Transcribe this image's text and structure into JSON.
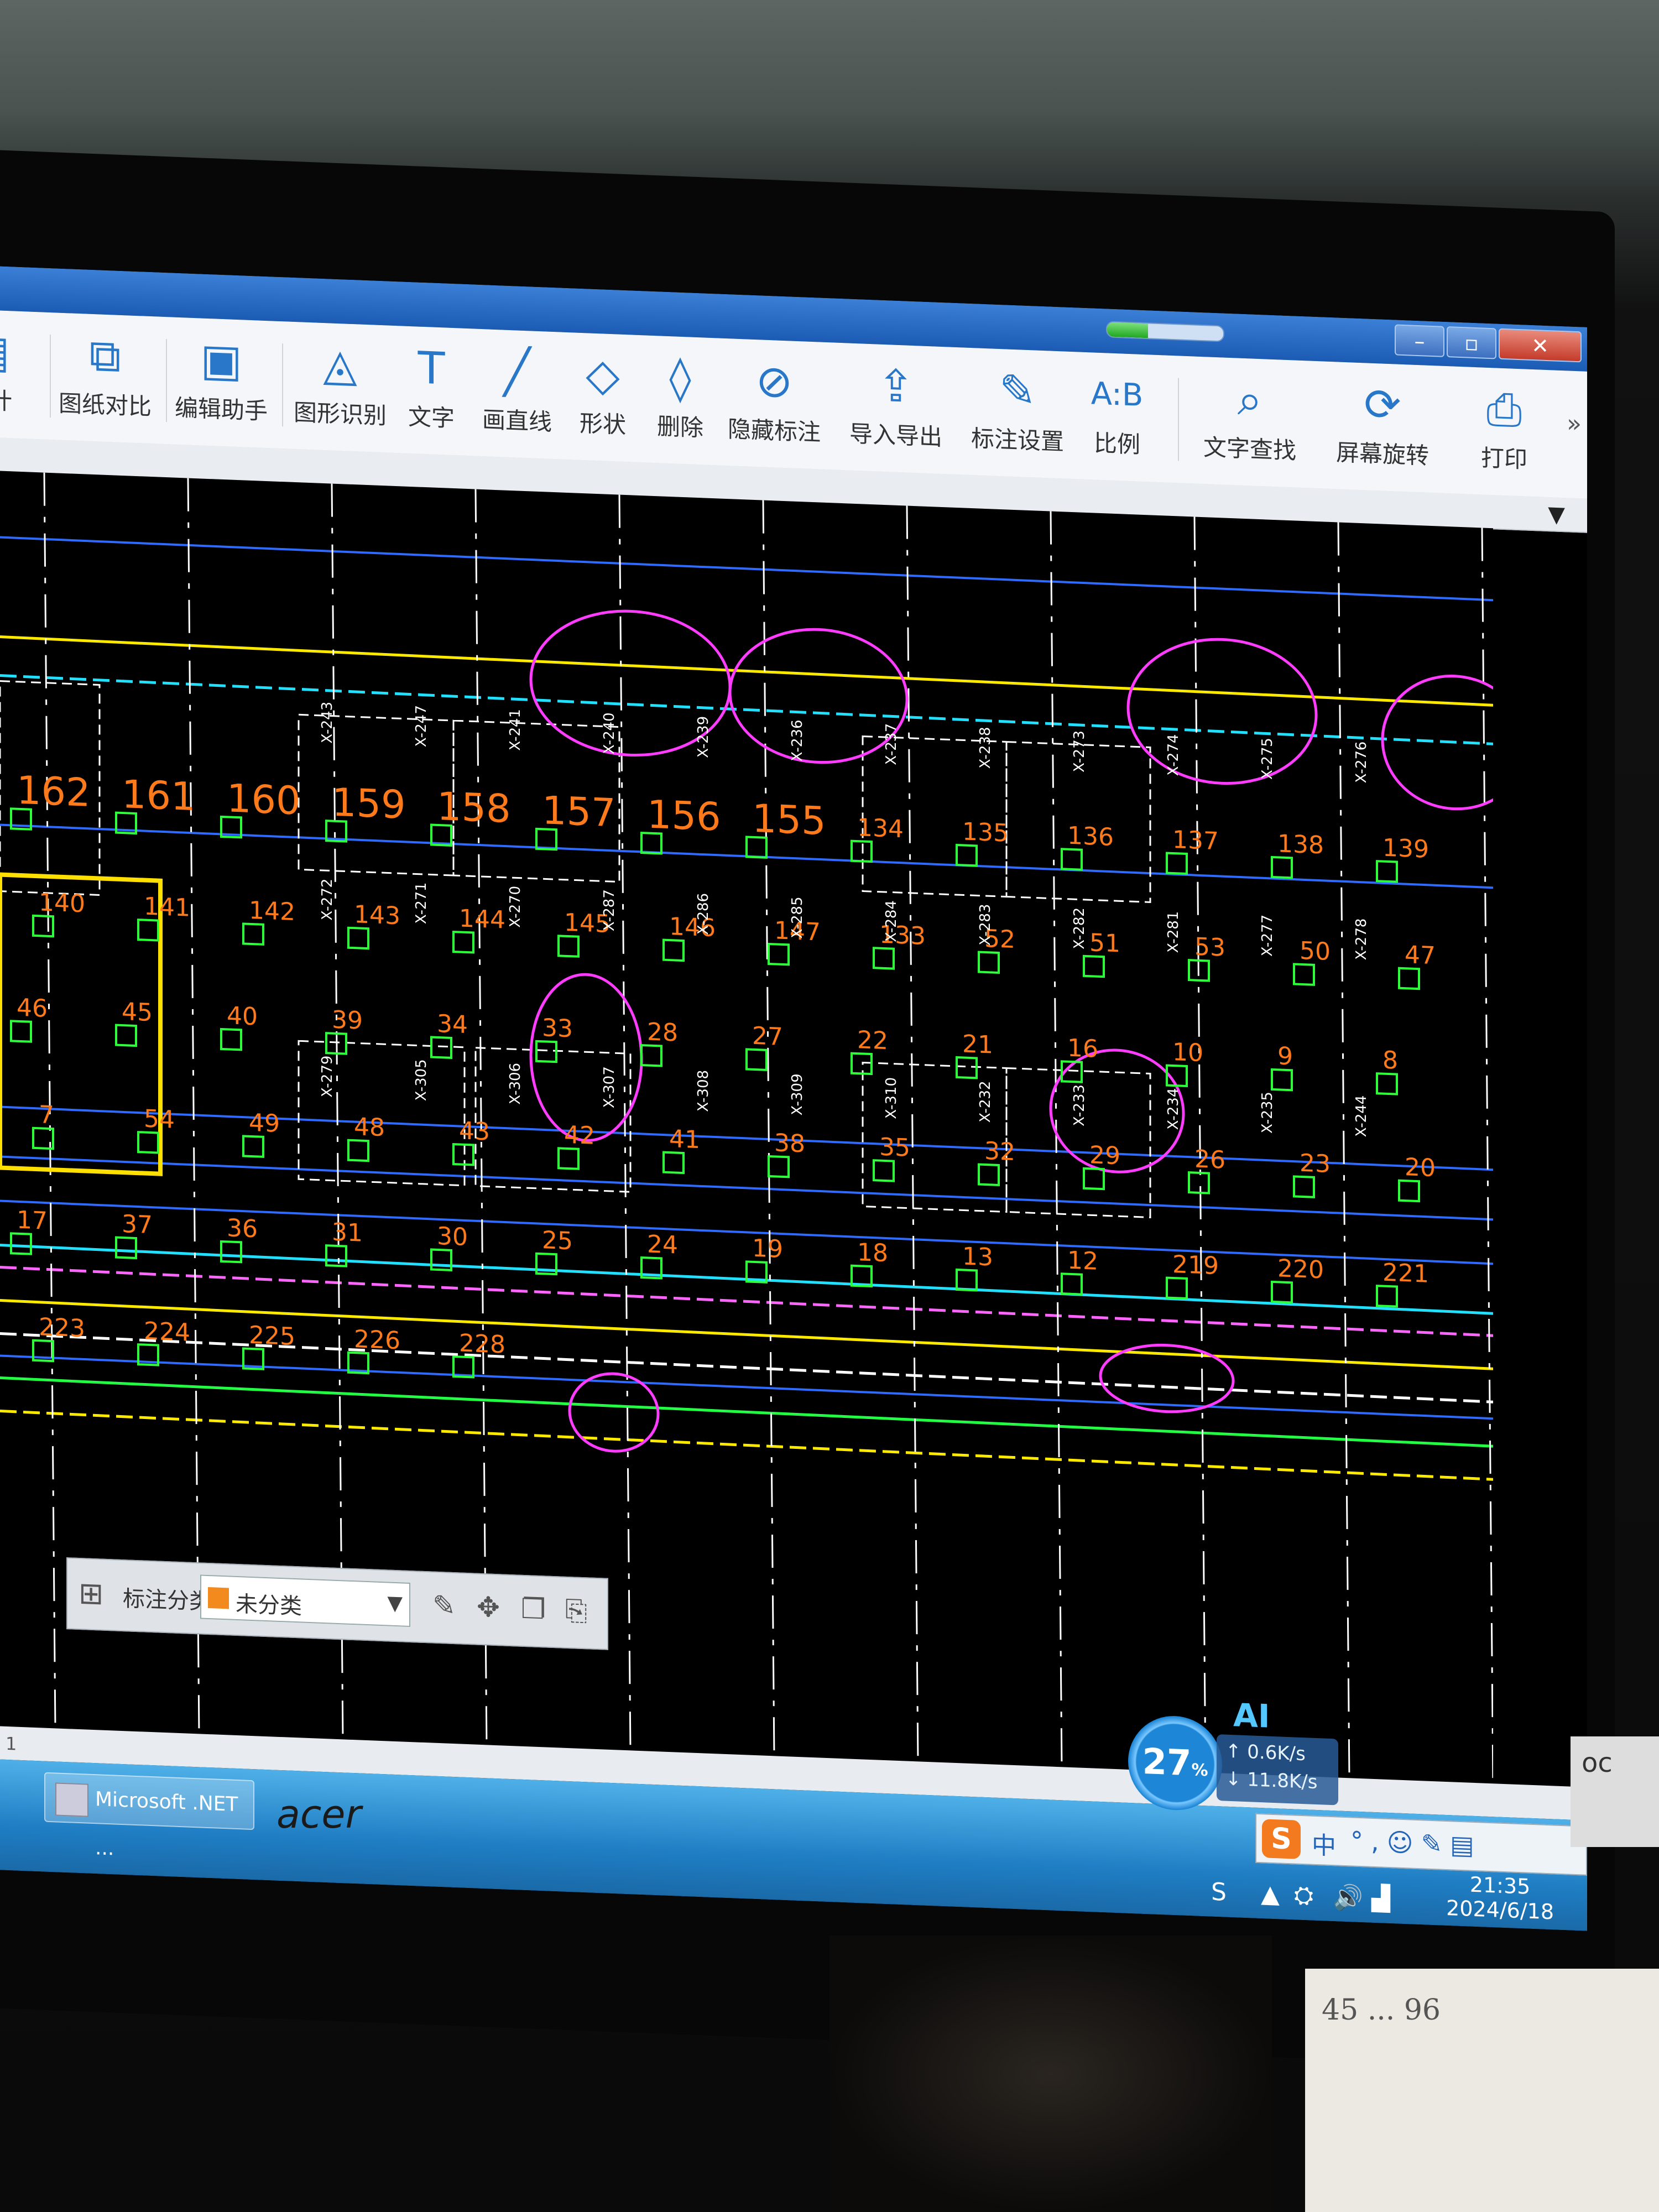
{
  "window": {
    "progress": 0.35,
    "buttons": {
      "minimize": "–",
      "maximize": "▫",
      "close": "✕"
    }
  },
  "toolbar": {
    "items": [
      {
        "label": "统计",
        "icon": "stats-icon"
      },
      {
        "label": "图纸对比",
        "icon": "compare-icon"
      },
      {
        "label": "编辑助手",
        "icon": "edit-helper-icon"
      },
      {
        "label": "图形识别",
        "icon": "shape-recognition-icon"
      },
      {
        "label": "文字",
        "icon": "text-icon"
      },
      {
        "label": "画直线",
        "icon": "line-icon"
      },
      {
        "label": "形状",
        "icon": "shape-icon"
      },
      {
        "label": "删除",
        "icon": "eraser-icon"
      },
      {
        "label": "隐藏标注",
        "icon": "hide-annotation-icon"
      },
      {
        "label": "导入导出",
        "icon": "import-export-icon"
      },
      {
        "label": "标注设置",
        "icon": "annotation-settings-icon"
      },
      {
        "label": "比例",
        "icon": "scale-icon"
      },
      {
        "label": "文字查找",
        "icon": "text-search-icon"
      },
      {
        "label": "屏幕旋转",
        "icon": "screen-rotate-icon"
      },
      {
        "label": "打印",
        "icon": "print-icon"
      }
    ],
    "more": "»"
  },
  "drawing": {
    "room_labels": [
      "162",
      "161",
      "160",
      "159",
      "158",
      "157",
      "156",
      "155",
      "134",
      "135",
      "136",
      "137",
      "138",
      "139",
      "140",
      "141",
      "142",
      "143",
      "144",
      "145",
      "146",
      "147",
      "133",
      "52",
      "51",
      "53",
      "50",
      "47",
      "46",
      "45",
      "40",
      "39",
      "34",
      "33",
      "28",
      "27",
      "22",
      "21",
      "16",
      "10",
      "9",
      "8",
      "7",
      "54",
      "49",
      "48",
      "43",
      "42",
      "41",
      "38",
      "35",
      "32",
      "29",
      "26",
      "23",
      "20",
      "17",
      "37",
      "36",
      "31",
      "30",
      "25",
      "24",
      "19",
      "18",
      "13",
      "12",
      "219",
      "220",
      "221",
      "223",
      "224",
      "225",
      "226",
      "228"
    ],
    "room_tags": [
      "X-243",
      "X-247",
      "X-241",
      "X-240",
      "X-239",
      "X-236",
      "X-237",
      "X-238",
      "X-273",
      "X-274",
      "X-275",
      "X-276",
      "X-272",
      "X-271",
      "X-270",
      "X-287",
      "X-286",
      "X-285",
      "X-284",
      "X-283",
      "X-282",
      "X-281",
      "X-277",
      "X-278",
      "X-279",
      "X-305",
      "X-306",
      "X-307",
      "X-308",
      "X-309",
      "X-310",
      "X-232",
      "X-233",
      "X-234",
      "X-235",
      "X-244"
    ]
  },
  "annotation_bar": {
    "label": "标注分类",
    "selected": "未分类",
    "icons": [
      "edit-annotation-icon",
      "move-icon",
      "copy-icon",
      "paste-icon"
    ]
  },
  "statusline": {
    "text": "1"
  },
  "taskbar": {
    "task": "Microsoft .NET ...",
    "ime": {
      "mode": "中"
    },
    "clock": {
      "time": "21:35",
      "date": "2024/6/18"
    }
  },
  "net_widget": {
    "cpu": "27",
    "cpu_unit": "%",
    "up": "0.6K/s",
    "down": "11.8K/s",
    "ai": "AI"
  },
  "desk": {
    "note": "45 ... 96",
    "monitor_brand": "acer",
    "side_label": "oc"
  }
}
